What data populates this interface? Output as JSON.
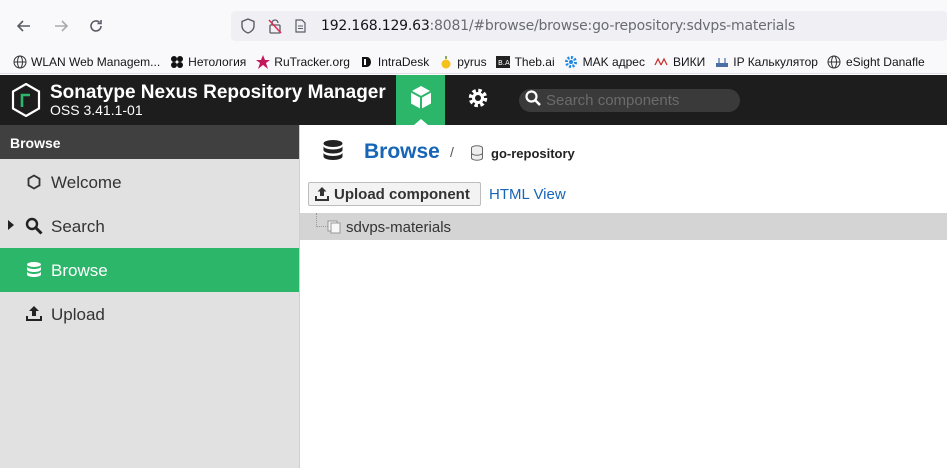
{
  "browser": {
    "back_icon": "arrow-left-icon",
    "forward_icon": "arrow-right-icon",
    "reload_icon": "reload-icon",
    "url_host": "192.168.129.63",
    "url_rest": ":8081/#browse/browse:go-repository:sdvps-materials"
  },
  "bookmarks": [
    {
      "label": "WLAN Web Managem...",
      "icon": "globe-icon"
    },
    {
      "label": "Нетология",
      "icon": "netology-icon"
    },
    {
      "label": "RuTracker.org",
      "icon": "rutracker-icon"
    },
    {
      "label": "IntraDesk",
      "icon": "intradesk-icon"
    },
    {
      "label": "pyrus",
      "icon": "pyrus-icon"
    },
    {
      "label": "Theb.ai",
      "icon": "thebai-icon"
    },
    {
      "label": "MAK адрес",
      "icon": "gear-blue-icon"
    },
    {
      "label": "ВИКИ",
      "icon": "wiki-icon"
    },
    {
      "label": "IP Калькулятор",
      "icon": "router-icon"
    },
    {
      "label": "eSight Danafle",
      "icon": "globe-icon"
    }
  ],
  "header": {
    "title": "Sonatype Nexus Repository Manager",
    "version": "OSS 3.41.1-01",
    "search_placeholder": "Search components"
  },
  "sidebar": {
    "heading": "Browse",
    "items": [
      {
        "label": "Welcome",
        "icon": "hexagon-icon",
        "active": false
      },
      {
        "label": "Search",
        "icon": "search-icon",
        "active": false
      },
      {
        "label": "Browse",
        "icon": "database-icon",
        "active": true
      },
      {
        "label": "Upload",
        "icon": "upload-icon",
        "active": false
      }
    ]
  },
  "main": {
    "breadcrumb_title": "Browse",
    "breadcrumb_separator": "/",
    "repository": "go-repository",
    "upload_button": "Upload component",
    "html_view": "HTML View",
    "tree": [
      {
        "label": "sdvps-materials",
        "icon": "folder-icon"
      }
    ]
  },
  "colors": {
    "accent": "#2cb66a",
    "header_bg": "#1d1d1d",
    "link": "#1765b7"
  }
}
